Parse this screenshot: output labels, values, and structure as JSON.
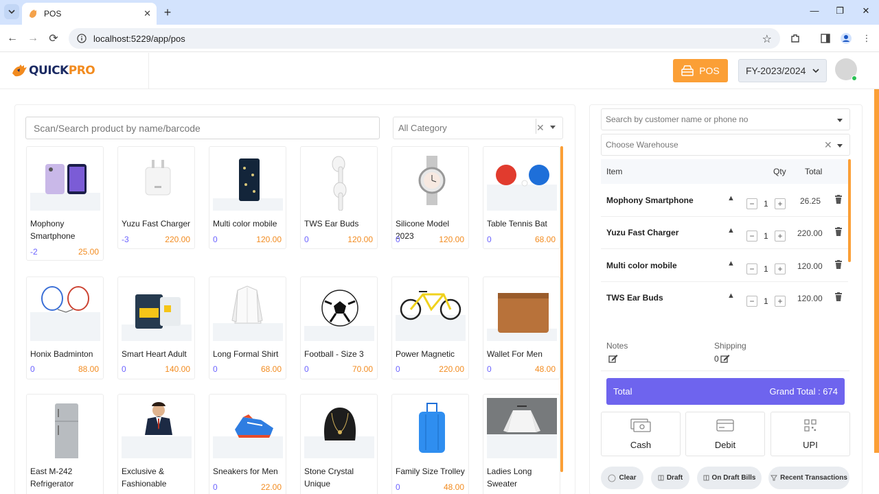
{
  "browser": {
    "tab_title": "POS",
    "url": "localhost:5229/app/pos"
  },
  "header": {
    "logo_part1": "QUICK",
    "logo_part2": "PRO",
    "pos_label": "POS",
    "fy_value": "FY-2023/2024"
  },
  "products": {
    "search_placeholder": "Scan/Search product by name/barcode",
    "category_value": "All Category",
    "items": [
      {
        "name": "Mophony Smartphone",
        "stock": "-2",
        "price": "25.00"
      },
      {
        "name": "Yuzu Fast Charger",
        "stock": "-3",
        "price": "220.00"
      },
      {
        "name": "Multi color mobile",
        "stock": "0",
        "price": "120.00"
      },
      {
        "name": "TWS Ear Buds",
        "stock": "0",
        "price": "120.00"
      },
      {
        "name": "Silicone Model 2023",
        "stock": "0",
        "price": "120.00"
      },
      {
        "name": "Table Tennis Bat",
        "stock": "0",
        "price": "68.00"
      },
      {
        "name": "Honix Badminton",
        "stock": "0",
        "price": "88.00"
      },
      {
        "name": "Smart Heart Adult",
        "stock": "0",
        "price": "140.00"
      },
      {
        "name": "Long Formal Shirt",
        "stock": "0",
        "price": "68.00"
      },
      {
        "name": "Football - Size 3",
        "stock": "0",
        "price": "70.00"
      },
      {
        "name": "Power Magnetic",
        "stock": "0",
        "price": "220.00"
      },
      {
        "name": "Wallet For Men",
        "stock": "0",
        "price": "48.00"
      },
      {
        "name": "East M-242 Refrigerator",
        "stock": "",
        "price": ""
      },
      {
        "name": "Exclusive & Fashionable",
        "stock": "",
        "price": ""
      },
      {
        "name": "Sneakers for Men",
        "stock": "0",
        "price": "22.00"
      },
      {
        "name": "Stone Crystal Unique",
        "stock": "",
        "price": ""
      },
      {
        "name": "Family Size Trolley",
        "stock": "0",
        "price": "48.00"
      },
      {
        "name": "Ladies Long Sweater",
        "stock": "",
        "price": ""
      }
    ]
  },
  "cart": {
    "customer_placeholder": "Search by customer name or phone no",
    "warehouse_placeholder": "Choose Warehouse",
    "col_item": "Item",
    "col_qty": "Qty",
    "col_total": "Total",
    "rows": [
      {
        "name": "Mophony Smartphone",
        "qty": "1",
        "total": "26.25"
      },
      {
        "name": "Yuzu Fast Charger",
        "qty": "1",
        "total": "220.00"
      },
      {
        "name": "Multi color mobile",
        "qty": "1",
        "total": "120.00"
      },
      {
        "name": "TWS Ear Buds",
        "qty": "1",
        "total": "120.00"
      }
    ],
    "notes_label": "Notes",
    "shipping_label": "Shipping",
    "shipping_value": "0",
    "total_label": "Total",
    "grand_total": "Grand Total : 674",
    "payments": [
      {
        "label": "Cash",
        "icon": "cash-icon"
      },
      {
        "label": "Debit",
        "icon": "card-icon"
      },
      {
        "label": "UPI",
        "icon": "qr-icon"
      }
    ],
    "actions": [
      {
        "label": "Clear"
      },
      {
        "label": "Draft"
      },
      {
        "label": "On Draft Bills"
      },
      {
        "label": "Recent Transactions"
      }
    ]
  },
  "colors": {
    "accent": "#fb9f36",
    "primary": "#6e64ee",
    "stock": "#6c63ff",
    "price": "#f28b1f"
  }
}
